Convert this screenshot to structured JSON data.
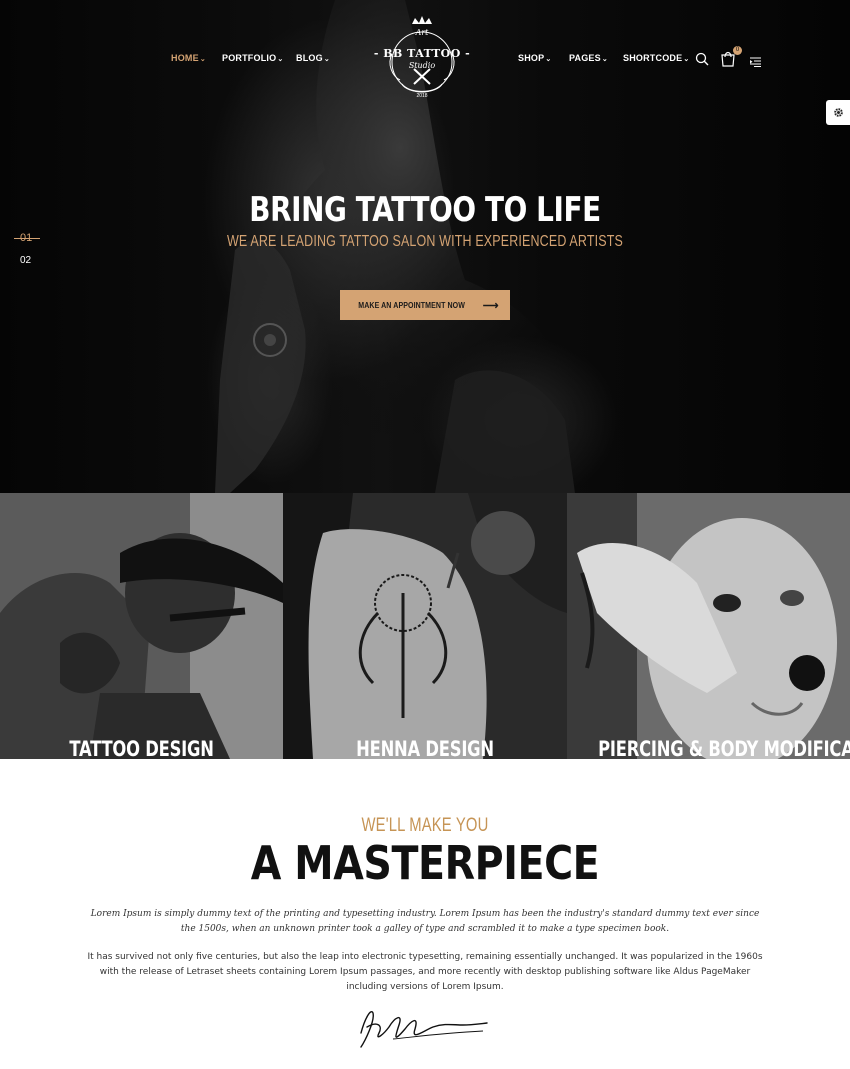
{
  "nav": {
    "left": [
      {
        "label": "HOME",
        "active": true
      },
      {
        "label": "PORTFOLIO",
        "active": false
      },
      {
        "label": "BLOG",
        "active": false
      }
    ],
    "right": [
      {
        "label": "SHOP"
      },
      {
        "label": "PAGES"
      },
      {
        "label": "SHORTCODE"
      }
    ],
    "chevron": "⌄",
    "cart_count": "0",
    "icons": [
      "search-icon",
      "cart-icon",
      "menu-icon",
      "gear-icon"
    ]
  },
  "logo": {
    "top": "Art",
    "main": "- BB TATTOO -",
    "sub": "Studio",
    "year": "2018"
  },
  "slider": {
    "current": "01",
    "next": "02"
  },
  "hero": {
    "title": "BRING TATTOO TO LIFE",
    "subtitle": "WE ARE LEADING TATTOO SALON WITH EXPERIENCED ARTISTS",
    "cta_label": "MAKE AN APPOINTMENT NOW",
    "cta_arrow": "⟶"
  },
  "services": [
    {
      "title": "TATTOO DESIGN"
    },
    {
      "title": "HENNA DESIGN"
    },
    {
      "title": "PIERCING & BODY MODIFICATON"
    }
  ],
  "about": {
    "kicker": "WE'LL MAKE YOU",
    "title": "A MASTERPIECE",
    "p1": "Lorem Ipsum is simply dummy text of the printing and typesetting industry. Lorem Ipsum has been the industry's standard dummy text ever since the 1500s, when an unknown printer took a galley of type and scrambled it to make a type specimen book.",
    "p2": "It has survived not only five centuries, but also the leap into electronic typesetting, remaining essentially unchanged. It was popularized in the 1960s with the release of Letraset sheets containing Lorem Ipsum passages, and more recently with desktop publishing software like Aldus PageMaker including versions of Lorem Ipsum."
  },
  "colors": {
    "accent": "#d4a373",
    "dark": "#0a0a0a",
    "text": "#333333"
  }
}
